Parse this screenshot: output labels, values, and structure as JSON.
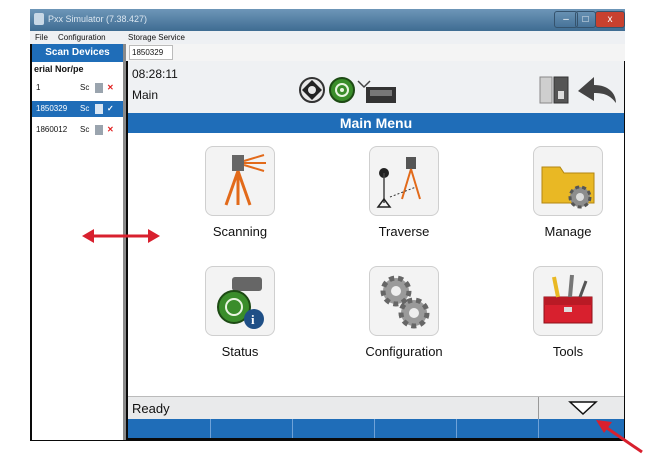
{
  "window": {
    "title": "Pxx Simulator (7.38.427)",
    "controls": [
      "minimize-icon",
      "maximize-icon",
      "close-icon"
    ]
  },
  "menubar": {
    "items": [
      "File",
      "Configuration",
      "Storage Service"
    ]
  },
  "sidebar": {
    "header": "Scan Devices",
    "column_header": "erial Nor/pe",
    "rows": [
      {
        "serial": "1",
        "type": "Sc",
        "selected": false
      },
      {
        "serial": "1850329",
        "type": "Sc",
        "selected": true
      },
      {
        "serial": "1860012",
        "type": "Sc",
        "selected": false
      }
    ]
  },
  "tab": {
    "label": "1850329"
  },
  "status": {
    "time": "08:28:11",
    "subtitle": "Main"
  },
  "banner": {
    "title": "Main Menu"
  },
  "tiles": [
    {
      "label": "Scanning",
      "icon": "scanner-tripod-icon"
    },
    {
      "label": "Traverse",
      "icon": "traverse-icon"
    },
    {
      "label": "Manage",
      "icon": "folder-gear-icon"
    },
    {
      "label": "Status",
      "icon": "target-info-icon"
    },
    {
      "label": "Configuration",
      "icon": "gears-icon"
    },
    {
      "label": "Tools",
      "icon": "toolbox-icon"
    }
  ],
  "bottom": {
    "status": "Ready"
  },
  "colors": {
    "accent": "#1f6db8",
    "arrow": "#d8202e",
    "close_x": "#e02020"
  }
}
